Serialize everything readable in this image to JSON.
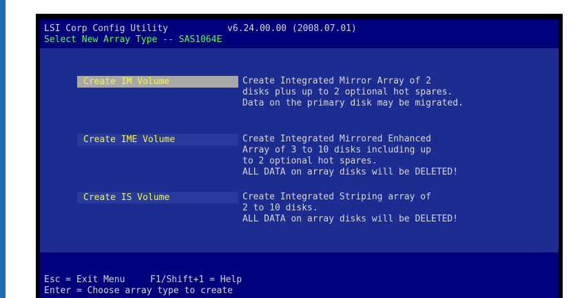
{
  "header": {
    "title": "LSI Corp Config Utility",
    "version": "v6.24.00.00 (2008.07.01)",
    "subtitle": "Select New Array Type -- SAS1064E"
  },
  "options": [
    {
      "label": "Create IM Volume",
      "selected": true,
      "description": [
        "Create Integrated Mirror Array of 2",
        "disks plus up to 2 optional hot spares.",
        "Data on the primary disk may be migrated."
      ]
    },
    {
      "label": "Create IME Volume",
      "selected": false,
      "description": [
        "Create Integrated Mirrored Enhanced",
        "Array of 3 to 10 disks including up",
        "to 2 optional hot spares.",
        "ALL DATA on array disks will be DELETED!"
      ]
    },
    {
      "label": "Create IS Volume",
      "selected": false,
      "description": [
        "Create Integrated Striping array of",
        "2 to 10 disks.",
        "ALL DATA on array disks will be DELETED!"
      ]
    }
  ],
  "footer": {
    "esc_hint": "Esc = Exit Menu",
    "help_hint": "F1/Shift+1 = Help",
    "enter_hint": "Enter = Choose array type to create"
  },
  "colors": {
    "background": "#1c2c90",
    "highlight": "#a8a8a8",
    "option_text": "#f5f542",
    "subtitle_text": "#55ff55"
  }
}
